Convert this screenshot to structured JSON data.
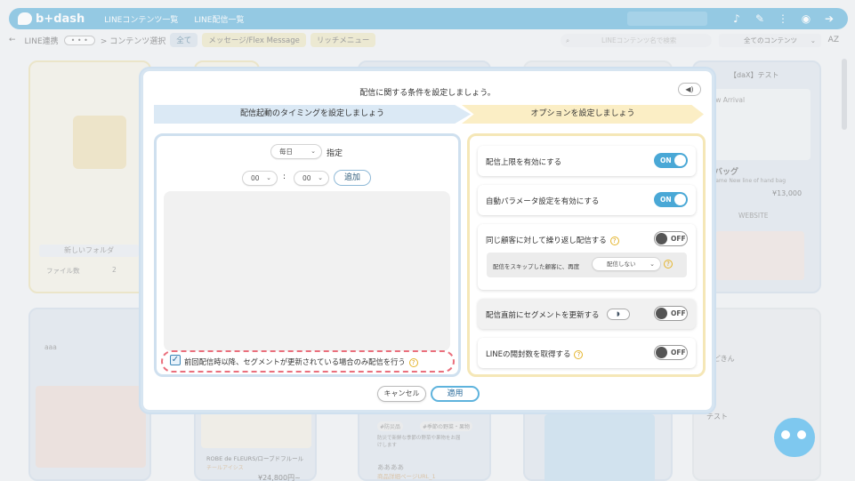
{
  "app": {
    "logo": "b+dash",
    "nav": [
      "LINEコンテンツ一覧",
      "LINE配信一覧"
    ]
  },
  "topicons": [
    "bell-icon",
    "wrench-icon",
    "grid-icon",
    "megaphone-icon",
    "logout-icon"
  ],
  "breadcrumb": {
    "back": "←",
    "root": "LINE連携",
    "dots": "• • •",
    "current": "> コンテンツ選択",
    "tabs": [
      "全て",
      "メッセージ/Flex Message",
      "リッチメニュー"
    ],
    "search_placeholder": "LINEコンテンツ名で検索",
    "filter": "全てのコンテンツ",
    "sort": "AZ"
  },
  "background": {
    "folder_name": "新しいフォルダ",
    "file_count_label": "ファイル数",
    "file_count": "2",
    "daX_title": "【daX】テスト",
    "new_arrival": "New Arrival",
    "bag_title": "ドバッグ",
    "bag_sub": "d Name New line of hand bag",
    "bag_price": "¥13,000",
    "website": "WEBSITE",
    "aaa": "aaa",
    "robe": "ROBE de FLEURS/ローブドフルール",
    "robe_sub": "チールアイシス",
    "robe_price": "¥24,800円~",
    "tag1": "#防災品",
    "tag2": "#季節の野菜・果物",
    "tag_text": "防災で新鮮な季節の野菜や果物をお届けします",
    "aaa2": "ああああ",
    "detail": "商品詳細ページURL_1",
    "right1": "もどきん",
    "right2": "テスト"
  },
  "modal": {
    "title": "配信に関する条件を設定しましょう。",
    "steps": [
      "配信起動のタイミングを設定しましょう",
      "オプションを設定しましょう"
    ],
    "left": {
      "frequency": "毎日",
      "specify": "指定",
      "hour": "00",
      "colon": ":",
      "minute": "00",
      "add": "追加",
      "segment_check": "前回配信時以降、セグメントが更新されている場合のみ配信を行う",
      "segment_checked": true
    },
    "options": [
      {
        "label": "配信上限を有効にする",
        "state": "ON"
      },
      {
        "label": "自動パラメータ設定を有効にする",
        "state": "ON"
      },
      {
        "label": "同じ顧客に対して繰り返し配信する",
        "state": "OFF",
        "help": true
      },
      {
        "label": "配信直前にセグメントを更新する",
        "state": "OFF"
      },
      {
        "label": "LINEの閲封数を取得する",
        "state": "OFF",
        "help": true
      }
    ],
    "skip_label": "配信をスキップした顧客に、再度",
    "skip_value": "配信しない",
    "cancel": "キャンセル",
    "apply": "適用"
  },
  "colors": {
    "brand": "#4aa8d6",
    "accent_red": "#ea6f7c",
    "help": "#e5b52b"
  }
}
